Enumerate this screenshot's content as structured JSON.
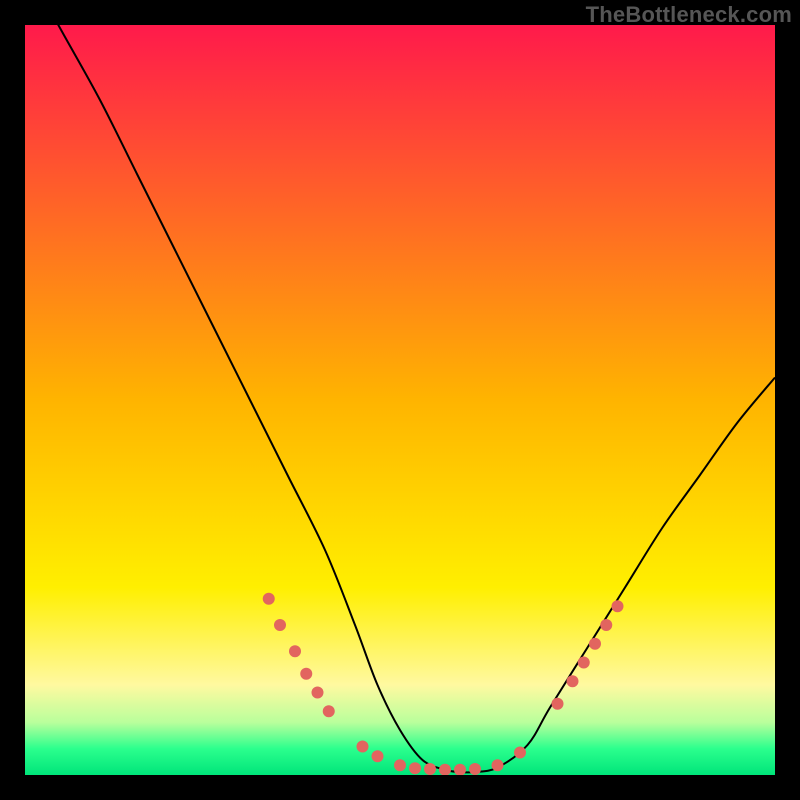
{
  "watermark": "TheBottleneck.com",
  "chart_data": {
    "type": "line",
    "title": "",
    "xlabel": "",
    "ylabel": "",
    "xlim": [
      0,
      100
    ],
    "ylim": [
      0,
      100
    ],
    "background_gradient": {
      "stops": [
        {
          "offset": 0.0,
          "color": "#ff1a4b"
        },
        {
          "offset": 0.5,
          "color": "#ffb400"
        },
        {
          "offset": 0.75,
          "color": "#ffef00"
        },
        {
          "offset": 0.88,
          "color": "#fff9a0"
        },
        {
          "offset": 0.93,
          "color": "#b9ff9c"
        },
        {
          "offset": 0.965,
          "color": "#2bff8d"
        },
        {
          "offset": 1.0,
          "color": "#00e57a"
        }
      ]
    },
    "series": [
      {
        "name": "bottleneck-curve",
        "color": "#000000",
        "x": [
          0,
          5,
          10,
          15,
          20,
          25,
          30,
          35,
          40,
          44,
          47,
          50,
          53,
          56,
          58,
          60,
          63,
          67,
          70,
          75,
          80,
          85,
          90,
          95,
          100
        ],
        "values": [
          108,
          99,
          90,
          80,
          70,
          60,
          50,
          40,
          30,
          20,
          12,
          6,
          2,
          0.7,
          0.4,
          0.4,
          1.0,
          4,
          9,
          17,
          25,
          33,
          40,
          47,
          53
        ]
      }
    ],
    "markers": {
      "name": "curve-dots",
      "color": "#e2655f",
      "radius_px": 6,
      "points": [
        {
          "x": 32.5,
          "y": 23.5
        },
        {
          "x": 34.0,
          "y": 20.0
        },
        {
          "x": 36.0,
          "y": 16.5
        },
        {
          "x": 37.5,
          "y": 13.5
        },
        {
          "x": 39.0,
          "y": 11.0
        },
        {
          "x": 40.5,
          "y": 8.5
        },
        {
          "x": 45.0,
          "y": 3.8
        },
        {
          "x": 47.0,
          "y": 2.5
        },
        {
          "x": 50.0,
          "y": 1.3
        },
        {
          "x": 52.0,
          "y": 0.9
        },
        {
          "x": 54.0,
          "y": 0.8
        },
        {
          "x": 56.0,
          "y": 0.7
        },
        {
          "x": 58.0,
          "y": 0.7
        },
        {
          "x": 60.0,
          "y": 0.8
        },
        {
          "x": 63.0,
          "y": 1.3
        },
        {
          "x": 66.0,
          "y": 3.0
        },
        {
          "x": 71.0,
          "y": 9.5
        },
        {
          "x": 73.0,
          "y": 12.5
        },
        {
          "x": 74.5,
          "y": 15.0
        },
        {
          "x": 76.0,
          "y": 17.5
        },
        {
          "x": 77.5,
          "y": 20.0
        },
        {
          "x": 79.0,
          "y": 22.5
        }
      ]
    }
  }
}
